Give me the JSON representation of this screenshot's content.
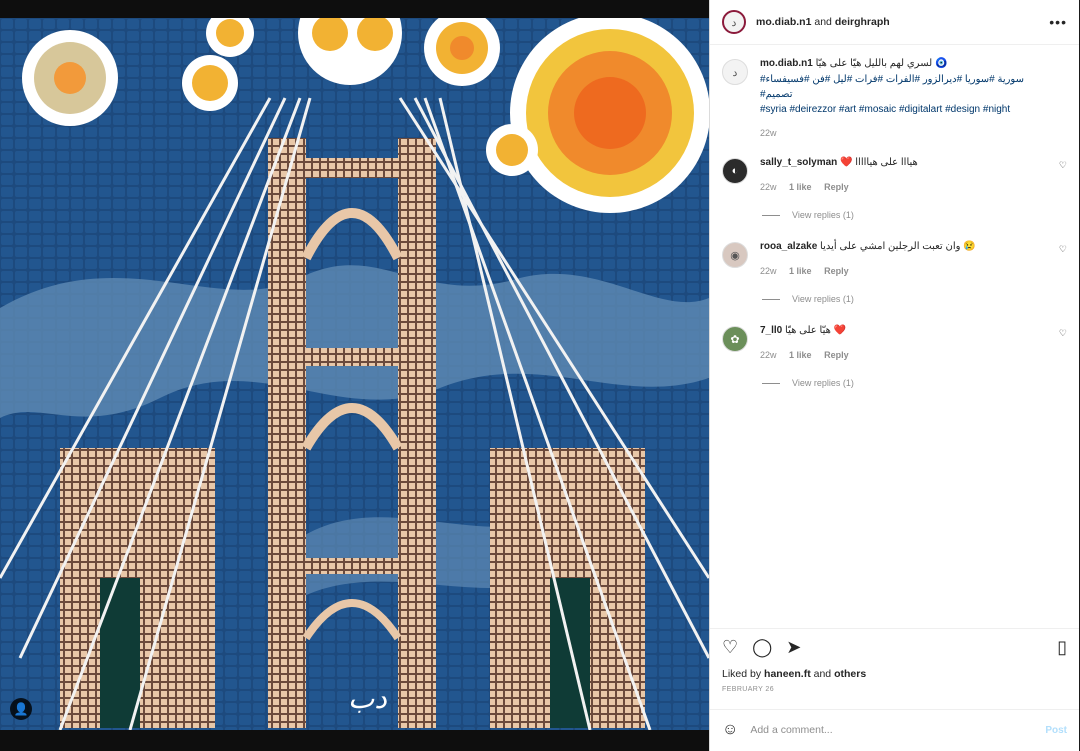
{
  "header": {
    "username": "mo.diab.n1",
    "and": "and",
    "collaborator": "deirghraph",
    "more": "•••"
  },
  "caption": {
    "username": "mo.diab.n1",
    "text": "لسري لهم بالليل هيّا على هيّا",
    "emoji": "🧿",
    "tags_arabic": "سورية #سوريا #ديرالزور #الفرات #فرات #ليل #فن #فسيفساء#",
    "tags_arabic2": "#تصميم",
    "tags_english": "#syria #deirezzor #art #mosaic #digitalart #design #night",
    "time": "22w"
  },
  "comments": [
    {
      "username": "sally_t_solyman",
      "text": "هيااا على هيااااا",
      "emoji": "❤️",
      "time": "22w",
      "likes": "1 like",
      "reply": "Reply",
      "view_replies": "View replies (1)"
    },
    {
      "username": "rooa_alzake",
      "text": "وان تعبت الرجلين امشي على أيديا",
      "emoji": "😢",
      "time": "22w",
      "likes": "1 like",
      "reply": "Reply",
      "view_replies": "View replies (1)"
    },
    {
      "username": "7_ll0",
      "text": "هيّا على هيّا",
      "emoji": "❤️",
      "time": "22w",
      "likes": "1 like",
      "reply": "Reply",
      "view_replies": "View replies (1)"
    }
  ],
  "likes": {
    "prefix": "Liked by",
    "user": "haneen.ft",
    "and": "and",
    "others": "others"
  },
  "date": "FEBRUARY 26",
  "add_comment": {
    "placeholder": "Add a comment...",
    "post": "Post"
  },
  "icons": {
    "like": "heart-icon",
    "comment": "comment-icon",
    "share": "share-icon",
    "save": "bookmark-icon",
    "emoji": "emoji-icon"
  },
  "colors": {
    "sky": "#1f4f86",
    "sun": "#f2b233",
    "tower": "#e8c7a8",
    "link": "#00376b"
  }
}
